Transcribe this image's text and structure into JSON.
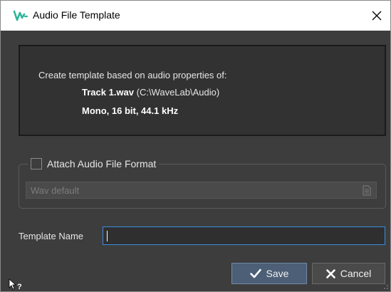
{
  "window": {
    "title": "Audio File Template",
    "app_icon": "wavelab-logo-icon",
    "close_icon": "close-icon"
  },
  "info": {
    "intro": "Create template based on audio properties of:",
    "file_name": "Track 1.wav",
    "file_path": " (C:\\WaveLab\\Audio)",
    "properties": "Mono, 16 bit, 44.1 kHz"
  },
  "attach": {
    "label": "Attach Audio File Format",
    "checked": false,
    "format_value": "Wav default",
    "format_icon": "document-list-icon"
  },
  "template_name": {
    "label": "Template Name",
    "value": ""
  },
  "buttons": {
    "save_label": "Save",
    "save_icon": "checkmark-icon",
    "cancel_label": "Cancel",
    "cancel_icon": "x-icon"
  },
  "footer": {
    "help_icon": "whats-this-help-icon"
  },
  "colors": {
    "background": "#3d3d3d",
    "panel": "#323232",
    "accent_focus": "#3a8de0",
    "save_button": "#4c5f76",
    "logo_green": "#2fb59a"
  }
}
